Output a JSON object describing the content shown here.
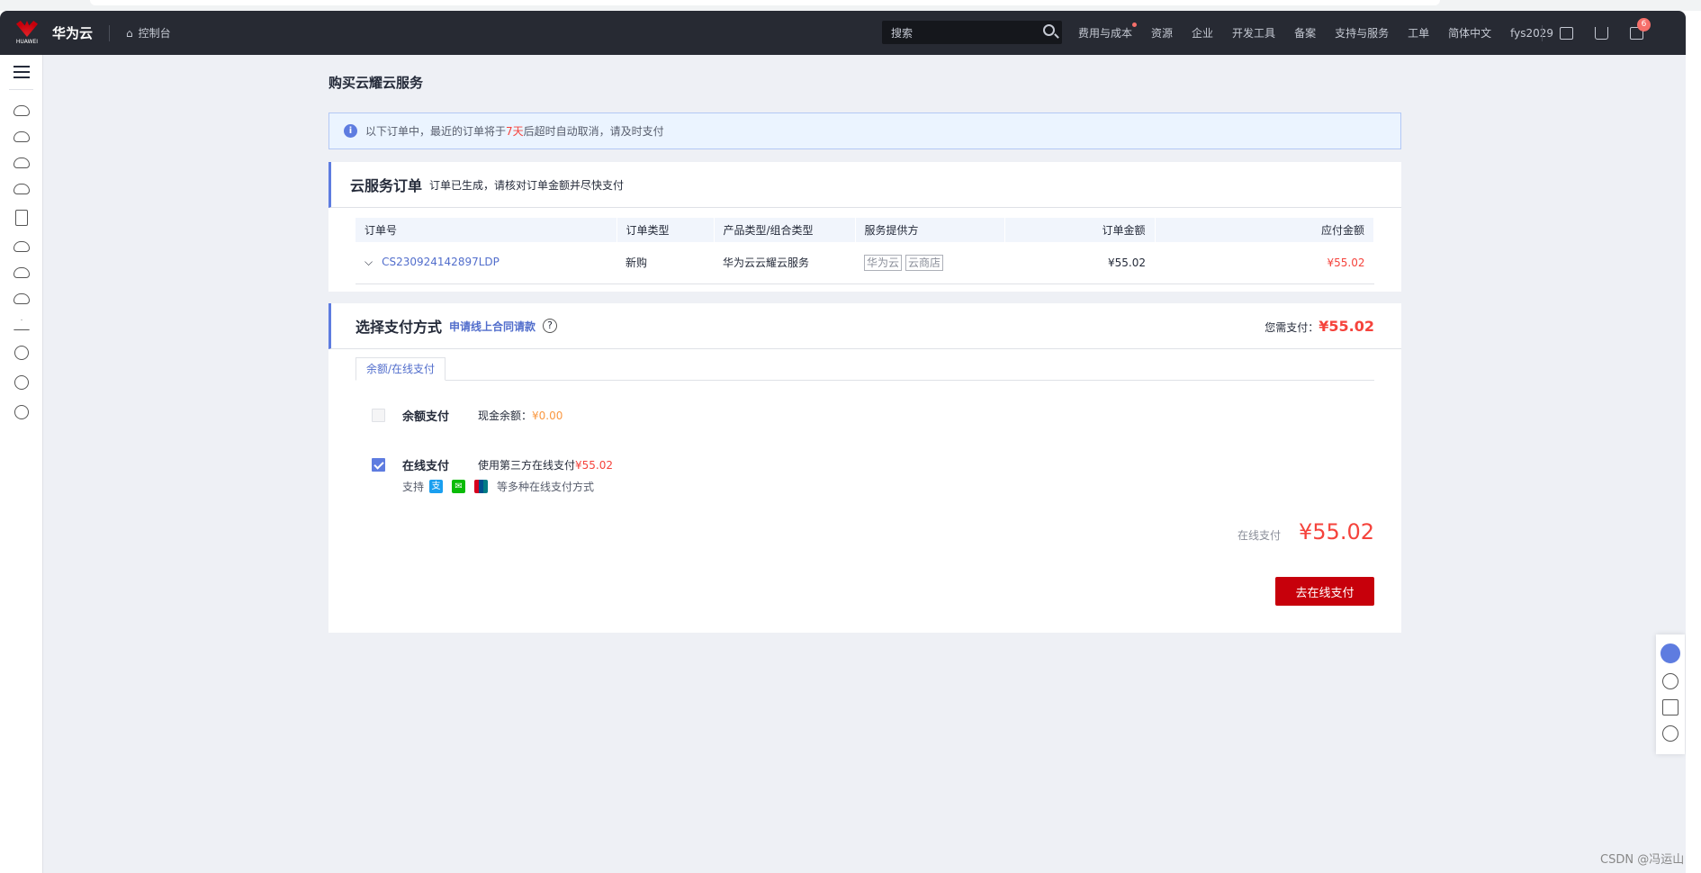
{
  "header": {
    "logo_text": "HUAWEI",
    "brand": "华为云",
    "console": "控制台",
    "search_placeholder": "搜索",
    "nav": [
      "费用与成本",
      "资源",
      "企业",
      "开发工具",
      "备案",
      "支持与服务",
      "工单",
      "简体中文",
      "fys2029"
    ],
    "message_count": "6"
  },
  "sidebar": {
    "icons": [
      "cloud-server-icon",
      "cloud-more-icon",
      "cloud-disk-icon",
      "network-icon",
      "mobile-cloud-icon",
      "cloud-icon",
      "cloud-upload-icon",
      "cloud-speed-icon",
      "pyramid-icon",
      "ip-icon",
      "cluster-icon",
      "globe-icon"
    ]
  },
  "page": {
    "title": "购买云耀云服务"
  },
  "alert": {
    "prefix": "以下订单中，最近的订单将于 ",
    "days": "7天",
    "suffix": " 后超时自动取消，请及时支付"
  },
  "order_card": {
    "title": "云服务订单",
    "subtitle": "订单已生成，请核对订单金额并尽快支付",
    "columns": [
      "订单号",
      "订单类型",
      "产品类型/组合类型",
      "服务提供方",
      "订单金额",
      "应付金额"
    ],
    "rows": [
      {
        "order_no": "CS230924142897LDP",
        "type": "新购",
        "product": "华为云云耀云服务",
        "providers": [
          "华为云",
          "云商店"
        ],
        "amount": "¥55.02",
        "payable": "¥55.02"
      }
    ]
  },
  "payment": {
    "title": "选择支付方式",
    "contract_link": "申请线上合同请款",
    "need_pay_label": "您需支付：",
    "need_pay": "¥55.02",
    "tab": "余额/在线支付",
    "balance": {
      "label": "余额支付",
      "desc": "现金余额：",
      "value": "¥0.00",
      "checked": false
    },
    "online": {
      "label": "在线支付",
      "desc": "使用第三方在线支付 ",
      "value": "¥55.02",
      "checked": true,
      "support_prefix": "支持",
      "support_suffix": "等多种在线支付方式"
    },
    "total_label": "在线支付",
    "total": "¥55.02",
    "pay_button": "去在线支付"
  },
  "watermark": "CSDN @冯运山",
  "colors": {
    "accent": "#5e7ce0",
    "price": "#f5433c",
    "button": "#c7000b",
    "header": "#272a33"
  }
}
